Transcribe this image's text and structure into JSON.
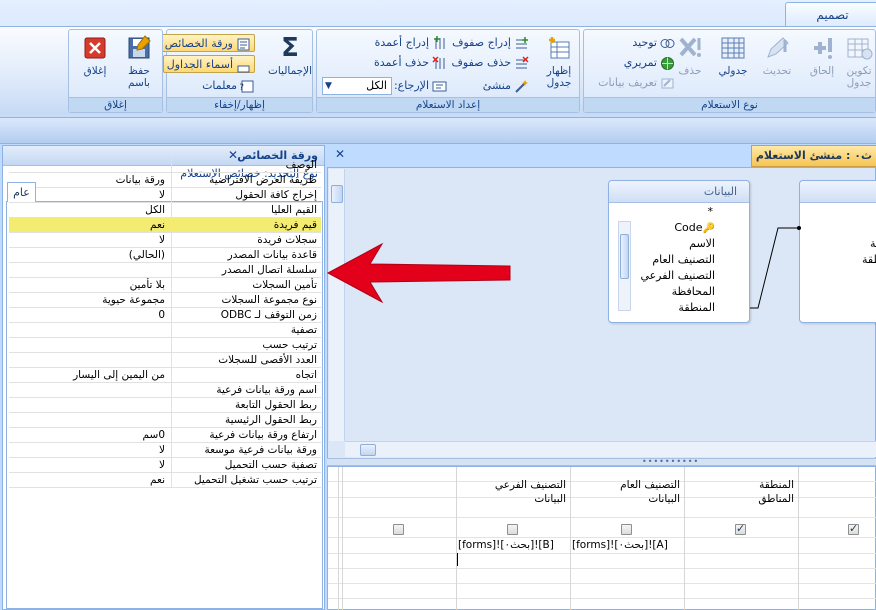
{
  "ribbon": {
    "context_tab": "تصميم",
    "groups": {
      "results": {
        "label": "إغلاق",
        "close": "إغلاق",
        "save_as": "حفظ باسم"
      },
      "show_hide": {
        "label": "إظهار/إخفاء",
        "totals": "الإجماليات",
        "property_sheet": "ورقة الخصائص",
        "table_names": "أسماء الجداول",
        "parameters": "معلمات"
      },
      "query_setup": {
        "label": "إعداد الاستعلام",
        "show_table": "إظهار جدول",
        "insert_rows": "إدراج صفوف",
        "delete_rows": "حذف صفوف",
        "builder": "منشئ",
        "insert_columns": "إدراج أعمدة",
        "delete_columns": "حذف أعمدة",
        "return": "الإرجاع:",
        "return_value": "الكل"
      },
      "query_type": {
        "label": "نوع الاستعلام",
        "union": "توحيد",
        "pass_through": "تمريري",
        "data_definition": "تعريف بيانات",
        "delete": "حذف",
        "crosstab": "جدولي",
        "update": "تحديث",
        "append": "إلحاق",
        "make_table": "تكوين جدول"
      }
    }
  },
  "property_sheet": {
    "title": "ورقة الخصائص",
    "selection_type": "نوع التحديد:  خصائص الاستعلام",
    "tab": "عام",
    "rows": [
      {
        "name": "الوصف",
        "value": ""
      },
      {
        "name": "طريقة العرض الافتراضية",
        "value": "ورقة بيانات"
      },
      {
        "name": "إخراج كافة الحقول",
        "value": "لا"
      },
      {
        "name": "القيم العليا",
        "value": "الكل"
      },
      {
        "name": "قيم فريدة",
        "value": "نعم"
      },
      {
        "name": "سجلات فريدة",
        "value": "لا"
      },
      {
        "name": "قاعدة بيانات المصدر",
        "value": "(الحالي)"
      },
      {
        "name": "سلسلة اتصال المصدر",
        "value": ""
      },
      {
        "name": "تأمين السجلات",
        "value": "بلا تأمين"
      },
      {
        "name": "نوع مجموعة السجلات",
        "value": "مجموعة حيوية"
      },
      {
        "name": "زمن التوقف لـ ODBC",
        "value": "0"
      },
      {
        "name": "تصفية",
        "value": ""
      },
      {
        "name": "ترتيب حسب",
        "value": ""
      },
      {
        "name": "العدد الأقصى للسجلات",
        "value": ""
      },
      {
        "name": "اتجاه",
        "value": "من اليمين إلى اليسار"
      },
      {
        "name": "اسم ورقة بيانات فرعية",
        "value": ""
      },
      {
        "name": "ربط الحقول التابعة",
        "value": ""
      },
      {
        "name": "ربط الحقول الرئيسية",
        "value": ""
      },
      {
        "name": "ارتفاع ورقة بيانات فرعية",
        "value": "0سم"
      },
      {
        "name": "ورقة بيانات فرعية موسعة",
        "value": "لا"
      },
      {
        "name": "تصفية حسب التحميل",
        "value": "لا"
      },
      {
        "name": "ترتيب حسب تشغيل التحميل",
        "value": "نعم"
      }
    ],
    "selected_index": 4
  },
  "designer": {
    "tab_title": "ث٠ : منشئ الاستعلام",
    "tables": [
      {
        "name": "البيانات",
        "fields": [
          "*",
          "Code",
          "الاسم",
          "التصنيف العام",
          "التصنيف الفرعي",
          "المحافظة",
          "المنطقة"
        ]
      },
      {
        "name": "",
        "fields": [
          "قة",
          "نطقة"
        ]
      }
    ],
    "grid": {
      "columns": [
        {
          "field": "المنطقة",
          "table": "المناطق",
          "show": true,
          "criteria": ""
        },
        {
          "field": "التصنيف العام",
          "table": "البيانات",
          "show": false,
          "criteria": "[forms]![بحث٠]![A]"
        },
        {
          "field": "التصنيف الفرعي",
          "table": "البيانات",
          "show": false,
          "criteria": "[forms]![بحث٠]![B]"
        },
        {
          "field": "",
          "table": "",
          "show": false,
          "criteria": ""
        }
      ],
      "extra_show_checked": true
    }
  },
  "colors": {
    "highlight": "#f4ec71",
    "arrow": "#e2001a",
    "ribbon": "#dfeafa"
  }
}
